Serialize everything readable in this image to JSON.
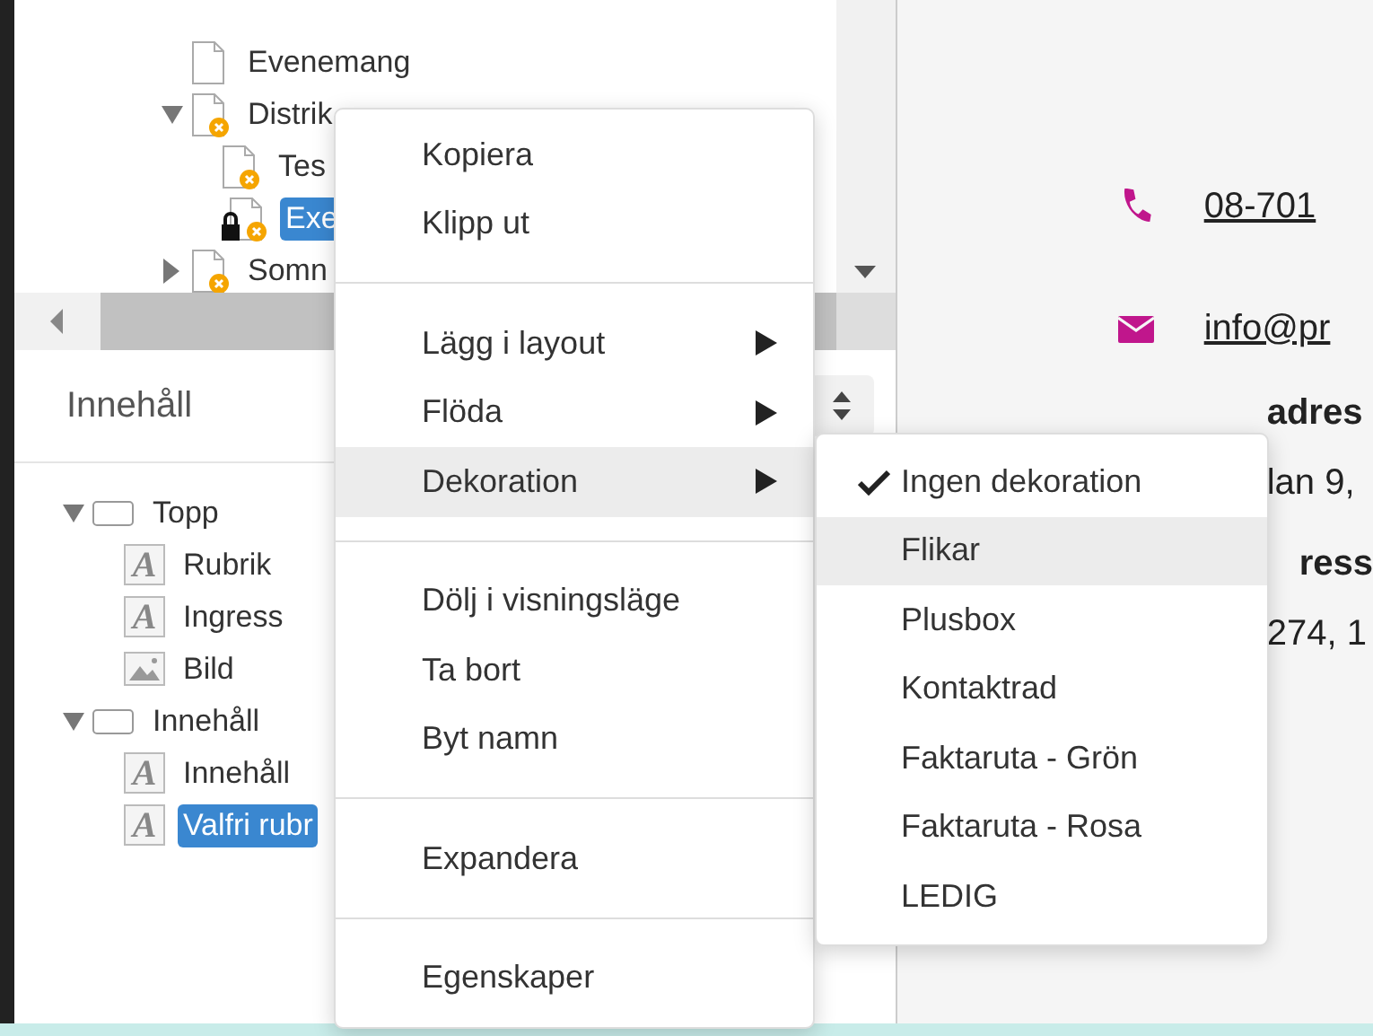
{
  "page_tree": {
    "items": [
      {
        "label": "Evenemang",
        "kind": "page",
        "selected": false,
        "locked": false
      },
      {
        "label": "Distrik",
        "kind": "draft",
        "selected": false,
        "locked": false,
        "expanded": true,
        "children": [
          {
            "label": "Tes",
            "kind": "draft",
            "selected": false,
            "locked": false
          },
          {
            "label": "Exe",
            "kind": "draft",
            "selected": true,
            "locked": true
          }
        ]
      },
      {
        "label": "Somn",
        "kind": "draft",
        "selected": false,
        "locked": false,
        "expanded": false
      }
    ]
  },
  "content_panel": {
    "title": "Innehåll",
    "items": [
      {
        "label": "Topp",
        "kind": "container",
        "selected": false,
        "expanded": true,
        "children": [
          {
            "label": "Rubrik",
            "kind": "text",
            "icon_text": "A",
            "selected": false
          },
          {
            "label": "Ingress",
            "kind": "text",
            "icon_text": "A",
            "selected": false
          },
          {
            "label": "Bild",
            "kind": "image",
            "selected": false
          }
        ]
      },
      {
        "label": "Innehåll",
        "kind": "container",
        "selected": false,
        "expanded": true,
        "children": [
          {
            "label": "Innehåll",
            "kind": "text",
            "icon_text": "A",
            "selected": false
          },
          {
            "label": "Valfri rubr",
            "kind": "text",
            "icon_text": "A",
            "selected": true
          }
        ]
      }
    ]
  },
  "preview": {
    "contacts": [
      {
        "kind": "phone",
        "text": "08-701"
      },
      {
        "kind": "email",
        "text": "info@pr"
      }
    ],
    "fields": [
      {
        "label": "adres",
        "value": "lan 9,"
      },
      {
        "label": "ress",
        "value": "274, 1"
      }
    ]
  },
  "context_menu": {
    "items": [
      {
        "kind": "item",
        "label": "Kopiera",
        "selected": false
      },
      {
        "kind": "item",
        "label": "Klipp ut",
        "selected": false
      },
      {
        "kind": "divider"
      },
      {
        "kind": "submenu",
        "label": "Lägg i layout",
        "selected": false
      },
      {
        "kind": "submenu",
        "label": "Flöda",
        "selected": false
      },
      {
        "kind": "submenu",
        "label": "Dekoration",
        "selected": true
      },
      {
        "kind": "divider"
      },
      {
        "kind": "item",
        "label": "Dölj i visningsläge",
        "selected": false
      },
      {
        "kind": "item",
        "label": "Ta bort",
        "selected": false
      },
      {
        "kind": "item",
        "label": "Byt namn",
        "selected": false
      },
      {
        "kind": "divider"
      },
      {
        "kind": "item",
        "label": "Expandera",
        "selected": false
      },
      {
        "kind": "divider"
      },
      {
        "kind": "item",
        "label": "Egenskaper",
        "selected": false
      }
    ]
  },
  "decoration_submenu": {
    "items": [
      {
        "label": "Ingen dekoration",
        "checked": true,
        "selected": false
      },
      {
        "label": "Flikar",
        "checked": false,
        "selected": true
      },
      {
        "label": "Plusbox",
        "checked": false,
        "selected": false
      },
      {
        "label": "Kontaktrad",
        "checked": false,
        "selected": false
      },
      {
        "label": "Faktaruta - Grön",
        "checked": false,
        "selected": false
      },
      {
        "label": "Faktaruta - Rosa",
        "checked": false,
        "selected": false
      },
      {
        "label": "LEDIG",
        "checked": false,
        "selected": false
      }
    ]
  }
}
